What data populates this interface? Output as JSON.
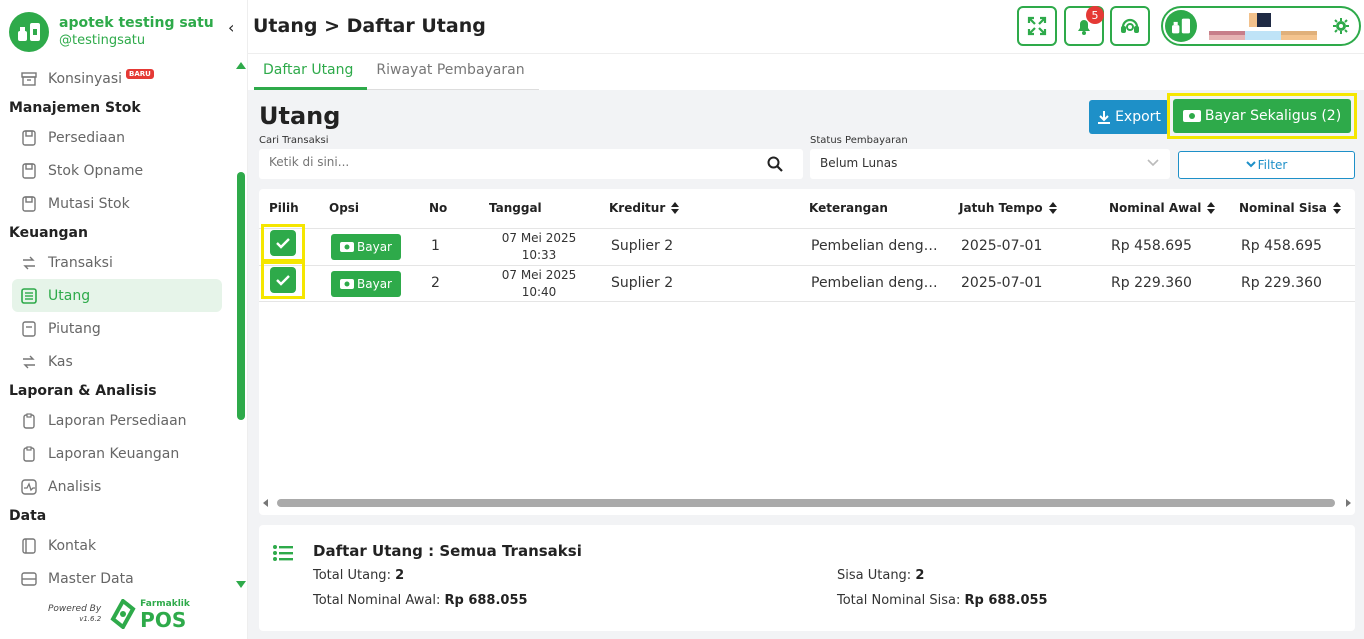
{
  "brand": {
    "name": "apotek testing satu",
    "handle": "@testingsatu"
  },
  "sidebar": {
    "items": [
      {
        "type": "item",
        "label": "Konsinyasi",
        "badge": "BARU",
        "icon": "box-icon"
      },
      {
        "type": "section",
        "label": "Manajemen Stok"
      },
      {
        "type": "item",
        "label": "Persediaan",
        "icon": "inventory-icon"
      },
      {
        "type": "item",
        "label": "Stok Opname",
        "icon": "clipboard-icon"
      },
      {
        "type": "item",
        "label": "Mutasi Stok",
        "icon": "transfer-icon"
      },
      {
        "type": "section",
        "label": "Keuangan"
      },
      {
        "type": "item",
        "label": "Transaksi",
        "icon": "exchange-icon"
      },
      {
        "type": "item",
        "label": "Utang",
        "icon": "ledger-icon",
        "active": true
      },
      {
        "type": "item",
        "label": "Piutang",
        "icon": "receivable-icon"
      },
      {
        "type": "item",
        "label": "Kas",
        "icon": "cash-icon"
      },
      {
        "type": "section",
        "label": "Laporan & Analisis"
      },
      {
        "type": "item",
        "label": "Laporan Persediaan",
        "icon": "report-icon"
      },
      {
        "type": "item",
        "label": "Laporan Keuangan",
        "icon": "report-icon"
      },
      {
        "type": "item",
        "label": "Analisis",
        "icon": "analytics-icon"
      },
      {
        "type": "section",
        "label": "Data"
      },
      {
        "type": "item",
        "label": "Kontak",
        "icon": "contact-icon"
      },
      {
        "type": "item",
        "label": "Master Data",
        "icon": "database-icon"
      }
    ]
  },
  "powered": {
    "label": "Powered By",
    "version": "v1.6.2",
    "brand_small": "Farmaklik",
    "brand_big": "POS"
  },
  "header": {
    "breadcrumb": "Utang > Daftar Utang",
    "notification_count": "5"
  },
  "tabs": [
    {
      "label": "Daftar Utang",
      "active": true
    },
    {
      "label": "Riwayat Pembayaran",
      "active": false
    }
  ],
  "main": {
    "title": "Utang",
    "export_label": "Export",
    "bayar_all_label": "Bayar Sekaligus (2)",
    "search": {
      "label": "Cari Transaksi",
      "placeholder": "Ketik di sini..."
    },
    "status": {
      "label": "Status Pembayaran",
      "value": "Belum Lunas"
    },
    "filter_label": "Filter"
  },
  "table": {
    "headers": [
      "Pilih",
      "Opsi",
      "No",
      "Tanggal",
      "Kreditur",
      "Keterangan",
      "Jatuh Tempo",
      "Nominal Awal",
      "Nominal Sisa"
    ],
    "pay_label": "Bayar",
    "rows": [
      {
        "no": "1",
        "date": "07 Mei 2025",
        "time": "10:33",
        "kreditur": "Suplier 2",
        "keterangan": "Pembelian deng…",
        "jatuh_tempo": "2025-07-01",
        "nominal_awal": "Rp 458.695",
        "nominal_sisa": "Rp 458.695",
        "checked": true
      },
      {
        "no": "2",
        "date": "07 Mei 2025",
        "time": "10:40",
        "kreditur": "Suplier 2",
        "keterangan": "Pembelian deng…",
        "jatuh_tempo": "2025-07-01",
        "nominal_awal": "Rp 229.360",
        "nominal_sisa": "Rp 229.360",
        "checked": true
      }
    ]
  },
  "summary": {
    "title": "Daftar Utang : Semua Transaksi",
    "total_utang_label": "Total Utang:",
    "total_utang": "2",
    "sisa_utang_label": "Sisa Utang:",
    "sisa_utang": "2",
    "total_awal_label": "Total Nominal Awal:",
    "total_awal": "Rp 688.055",
    "total_sisa_label": "Total Nominal Sisa:",
    "total_sisa": "Rp 688.055"
  },
  "colors": {
    "accent": "#2eaa4a",
    "blue": "#1e90c8",
    "highlight": "#f5e600",
    "danger": "#e53935"
  }
}
